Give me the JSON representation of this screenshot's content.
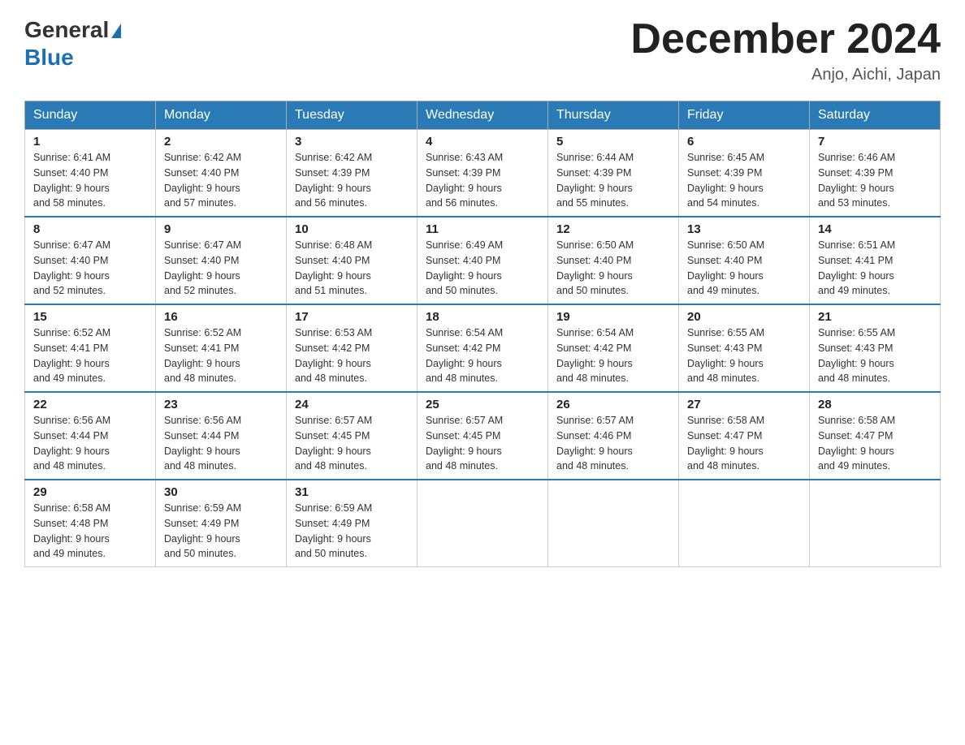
{
  "header": {
    "logo_general": "General",
    "logo_blue": "Blue",
    "month_title": "December 2024",
    "location": "Anjo, Aichi, Japan"
  },
  "days_of_week": [
    "Sunday",
    "Monday",
    "Tuesday",
    "Wednesday",
    "Thursday",
    "Friday",
    "Saturday"
  ],
  "weeks": [
    [
      {
        "day": "1",
        "sunrise": "6:41 AM",
        "sunset": "4:40 PM",
        "daylight": "9 hours and 58 minutes."
      },
      {
        "day": "2",
        "sunrise": "6:42 AM",
        "sunset": "4:40 PM",
        "daylight": "9 hours and 57 minutes."
      },
      {
        "day": "3",
        "sunrise": "6:42 AM",
        "sunset": "4:39 PM",
        "daylight": "9 hours and 56 minutes."
      },
      {
        "day": "4",
        "sunrise": "6:43 AM",
        "sunset": "4:39 PM",
        "daylight": "9 hours and 56 minutes."
      },
      {
        "day": "5",
        "sunrise": "6:44 AM",
        "sunset": "4:39 PM",
        "daylight": "9 hours and 55 minutes."
      },
      {
        "day": "6",
        "sunrise": "6:45 AM",
        "sunset": "4:39 PM",
        "daylight": "9 hours and 54 minutes."
      },
      {
        "day": "7",
        "sunrise": "6:46 AM",
        "sunset": "4:39 PM",
        "daylight": "9 hours and 53 minutes."
      }
    ],
    [
      {
        "day": "8",
        "sunrise": "6:47 AM",
        "sunset": "4:40 PM",
        "daylight": "9 hours and 52 minutes."
      },
      {
        "day": "9",
        "sunrise": "6:47 AM",
        "sunset": "4:40 PM",
        "daylight": "9 hours and 52 minutes."
      },
      {
        "day": "10",
        "sunrise": "6:48 AM",
        "sunset": "4:40 PM",
        "daylight": "9 hours and 51 minutes."
      },
      {
        "day": "11",
        "sunrise": "6:49 AM",
        "sunset": "4:40 PM",
        "daylight": "9 hours and 50 minutes."
      },
      {
        "day": "12",
        "sunrise": "6:50 AM",
        "sunset": "4:40 PM",
        "daylight": "9 hours and 50 minutes."
      },
      {
        "day": "13",
        "sunrise": "6:50 AM",
        "sunset": "4:40 PM",
        "daylight": "9 hours and 49 minutes."
      },
      {
        "day": "14",
        "sunrise": "6:51 AM",
        "sunset": "4:41 PM",
        "daylight": "9 hours and 49 minutes."
      }
    ],
    [
      {
        "day": "15",
        "sunrise": "6:52 AM",
        "sunset": "4:41 PM",
        "daylight": "9 hours and 49 minutes."
      },
      {
        "day": "16",
        "sunrise": "6:52 AM",
        "sunset": "4:41 PM",
        "daylight": "9 hours and 48 minutes."
      },
      {
        "day": "17",
        "sunrise": "6:53 AM",
        "sunset": "4:42 PM",
        "daylight": "9 hours and 48 minutes."
      },
      {
        "day": "18",
        "sunrise": "6:54 AM",
        "sunset": "4:42 PM",
        "daylight": "9 hours and 48 minutes."
      },
      {
        "day": "19",
        "sunrise": "6:54 AM",
        "sunset": "4:42 PM",
        "daylight": "9 hours and 48 minutes."
      },
      {
        "day": "20",
        "sunrise": "6:55 AM",
        "sunset": "4:43 PM",
        "daylight": "9 hours and 48 minutes."
      },
      {
        "day": "21",
        "sunrise": "6:55 AM",
        "sunset": "4:43 PM",
        "daylight": "9 hours and 48 minutes."
      }
    ],
    [
      {
        "day": "22",
        "sunrise": "6:56 AM",
        "sunset": "4:44 PM",
        "daylight": "9 hours and 48 minutes."
      },
      {
        "day": "23",
        "sunrise": "6:56 AM",
        "sunset": "4:44 PM",
        "daylight": "9 hours and 48 minutes."
      },
      {
        "day": "24",
        "sunrise": "6:57 AM",
        "sunset": "4:45 PM",
        "daylight": "9 hours and 48 minutes."
      },
      {
        "day": "25",
        "sunrise": "6:57 AM",
        "sunset": "4:45 PM",
        "daylight": "9 hours and 48 minutes."
      },
      {
        "day": "26",
        "sunrise": "6:57 AM",
        "sunset": "4:46 PM",
        "daylight": "9 hours and 48 minutes."
      },
      {
        "day": "27",
        "sunrise": "6:58 AM",
        "sunset": "4:47 PM",
        "daylight": "9 hours and 48 minutes."
      },
      {
        "day": "28",
        "sunrise": "6:58 AM",
        "sunset": "4:47 PM",
        "daylight": "9 hours and 49 minutes."
      }
    ],
    [
      {
        "day": "29",
        "sunrise": "6:58 AM",
        "sunset": "4:48 PM",
        "daylight": "9 hours and 49 minutes."
      },
      {
        "day": "30",
        "sunrise": "6:59 AM",
        "sunset": "4:49 PM",
        "daylight": "9 hours and 50 minutes."
      },
      {
        "day": "31",
        "sunrise": "6:59 AM",
        "sunset": "4:49 PM",
        "daylight": "9 hours and 50 minutes."
      },
      null,
      null,
      null,
      null
    ]
  ],
  "labels": {
    "sunrise": "Sunrise:",
    "sunset": "Sunset:",
    "daylight": "Daylight:"
  }
}
